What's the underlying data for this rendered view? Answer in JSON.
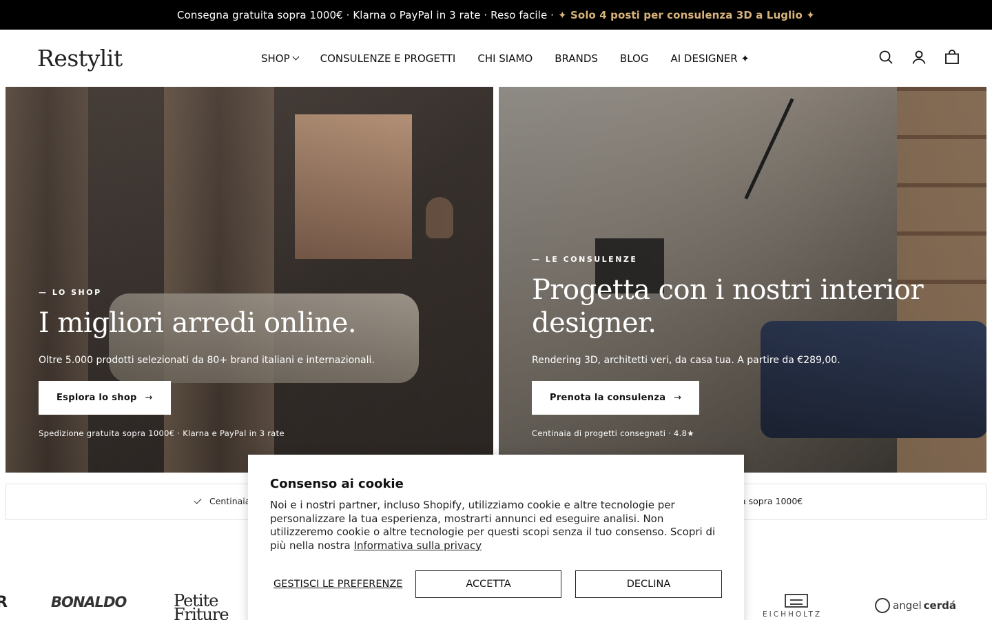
{
  "topbar": {
    "text": "Consegna gratuita sopra 1000€ · Klarna o PayPal in 3 rate · Reso facile ·",
    "promo": "✦ Solo 4 posti per consulenza 3D a Luglio ✦"
  },
  "header": {
    "logo": "Restylit",
    "nav": [
      "SHOP",
      "CONSULENZE E PROGETTI",
      "CHI SIAMO",
      "BRANDS",
      "BLOG",
      "AI DESIGNER ✦"
    ],
    "icons": [
      "search-icon",
      "account-icon",
      "cart-icon"
    ]
  },
  "hero_left": {
    "eyebrow": "— LO SHOP",
    "title": "I migliori arredi online.",
    "subtitle": "Oltre 5.000 prodotti selezionati da 80+ brand italiani e internazionali.",
    "button": "Esplora lo shop",
    "arrow": "→",
    "note": "Spedizione gratuita sopra 1000€ · Klarna e PayPal in 3 rate"
  },
  "hero_right": {
    "eyebrow": "— LE CONSULENZE",
    "title_line1": "Progetta con i nostri interior",
    "title_line2": "designer.",
    "subtitle": "Rendering 3D, architetti veri, da casa tua. A partire da €289,00.",
    "button": "Prenota la consulenza",
    "arrow": "→",
    "note": "Centinaia di progetti consegnati · 4.8★"
  },
  "trust": {
    "item_left": "Centinaia",
    "item_right": "a sopra 1000€"
  },
  "brands": {
    "partial": "R",
    "bonaldo": "BONALDO",
    "petite_1": "Petite",
    "petite_2": "Friture",
    "eichholtz": "EICHHOLTZ",
    "angel_1": "angel",
    "angel_2": "cerdá"
  },
  "cookie": {
    "title": "Consenso ai cookie",
    "text": "Noi e i nostri partner, incluso Shopify, utilizziamo cookie e altre tecnologie per personalizzare la tua esperienza, mostrarti annunci ed eseguire analisi. Non utilizzeremo cookie o altre tecnologie per questi scopi senza il tuo consenso. Scopri di più nella nostra",
    "link": "Informativa sulla privacy",
    "manage": "GESTISCI LE PREFERENZE",
    "accept": "ACCETTA",
    "decline": "DECLINA"
  },
  "colors": {
    "topbar_bg": "#000000",
    "promo": "#d7b27a",
    "text": "#111111"
  }
}
